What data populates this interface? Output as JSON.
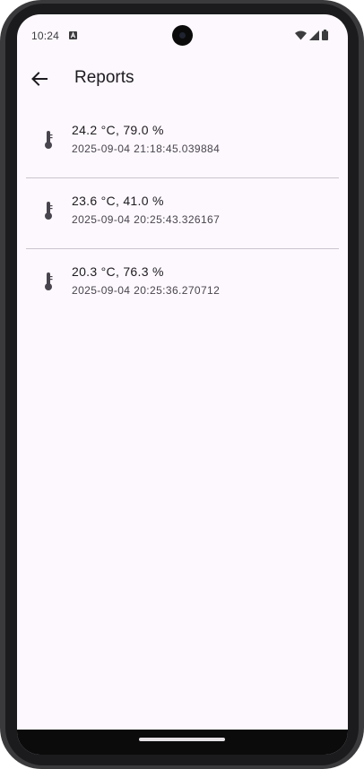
{
  "status_bar": {
    "time": "10:24",
    "icons": [
      "notification-a-icon",
      "wifi-icon",
      "signal-icon",
      "battery-icon"
    ]
  },
  "app_bar": {
    "back_icon": "arrow-back-icon",
    "title": "Reports"
  },
  "reports": [
    {
      "icon": "thermometer-icon",
      "reading": "24.2 °C, 79.0 %",
      "timestamp": "2025-09-04 21:18:45.039884"
    },
    {
      "icon": "thermometer-icon",
      "reading": "23.6 °C, 41.0 %",
      "timestamp": "2025-09-04 20:25:43.326167"
    },
    {
      "icon": "thermometer-icon",
      "reading": "20.3 °C, 76.3 %",
      "timestamp": "2025-09-04 20:25:36.270712"
    }
  ],
  "colors": {
    "background": "#fdf8fd",
    "divider": "#cac4d0",
    "text_primary": "#1d1b20",
    "text_secondary": "#49454f",
    "icon": "#49454f"
  }
}
